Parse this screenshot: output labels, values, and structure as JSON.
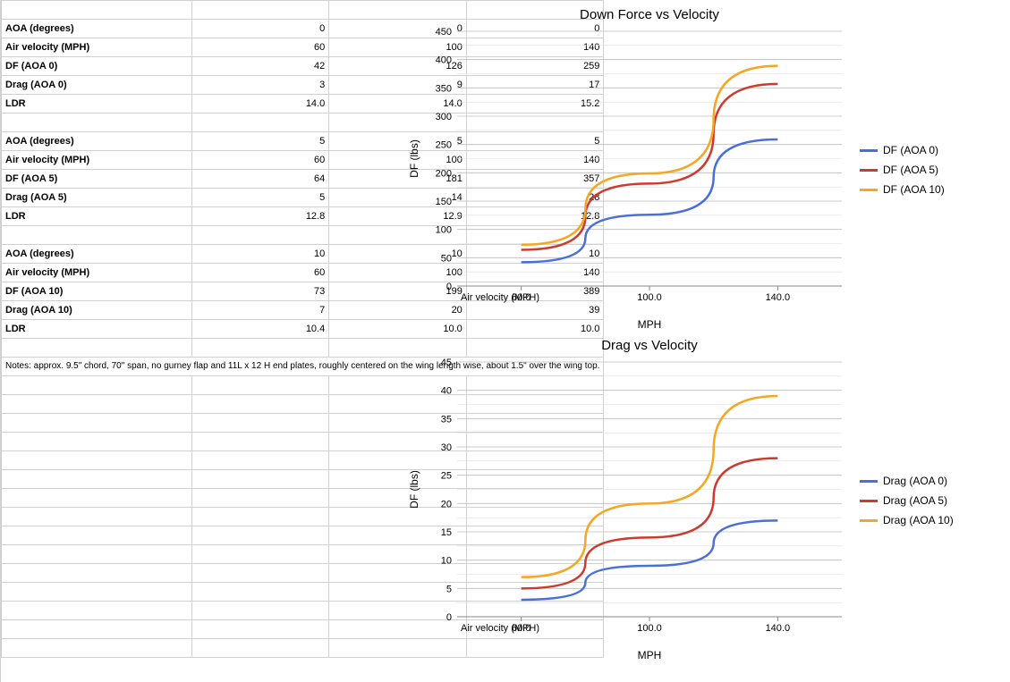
{
  "table": {
    "block0": {
      "rows": [
        {
          "label": "AOA (degrees)",
          "vals": [
            "0",
            "0",
            "0"
          ]
        },
        {
          "label": "Air velocity (MPH)",
          "vals": [
            "60",
            "100",
            "140"
          ]
        },
        {
          "label": "DF (AOA 0)",
          "vals": [
            "42",
            "126",
            "259"
          ]
        },
        {
          "label": "Drag (AOA 0)",
          "vals": [
            "3",
            "9",
            "17"
          ]
        },
        {
          "label": "LDR",
          "vals": [
            "14.0",
            "14.0",
            "15.2"
          ]
        }
      ]
    },
    "block1": {
      "rows": [
        {
          "label": "AOA (degrees)",
          "vals": [
            "5",
            "5",
            "5"
          ]
        },
        {
          "label": "Air velocity (MPH)",
          "vals": [
            "60",
            "100",
            "140"
          ]
        },
        {
          "label": "DF (AOA 5)",
          "vals": [
            "64",
            "181",
            "357"
          ]
        },
        {
          "label": "Drag (AOA 5)",
          "vals": [
            "5",
            "14",
            "28"
          ]
        },
        {
          "label": "LDR",
          "vals": [
            "12.8",
            "12.9",
            "12.8"
          ]
        }
      ]
    },
    "block2": {
      "rows": [
        {
          "label": "AOA (degrees)",
          "vals": [
            "10",
            "10",
            "10"
          ]
        },
        {
          "label": "Air velocity (MPH)",
          "vals": [
            "60",
            "100",
            "140"
          ]
        },
        {
          "label": "DF (AOA 10)",
          "vals": [
            "73",
            "199",
            "389"
          ]
        },
        {
          "label": "Drag (AOA 10)",
          "vals": [
            "7",
            "20",
            "39"
          ]
        },
        {
          "label": "LDR",
          "vals": [
            "10.4",
            "10.0",
            "10.0"
          ]
        }
      ]
    },
    "notes": "Notes: approx. 9.5\" chord, 70\" span, no gurney flap and 11L x 12 H end plates, roughly centered on the wing length wise, about 1.5\" over the wing top."
  },
  "chart_data": [
    {
      "type": "line",
      "title": "Down Force vs Velocity",
      "xlabel": "MPH",
      "ylabel": "DF (lbs)",
      "x_cat_label": "Air velocity (MPH)",
      "x_ticks": [
        "60.0",
        "100.0",
        "140.0"
      ],
      "ylim": [
        0,
        450
      ],
      "y_step": 50,
      "x": [
        60,
        100,
        140
      ],
      "series": [
        {
          "name": "DF (AOA 0)",
          "color": "#4a6fd8",
          "values": [
            42,
            126,
            259
          ]
        },
        {
          "name": "DF (AOA 5)",
          "color": "#cc3b2f",
          "values": [
            64,
            181,
            357
          ]
        },
        {
          "name": "DF (AOA 10)",
          "color": "#f5a623",
          "values": [
            73,
            199,
            389
          ]
        }
      ]
    },
    {
      "type": "line",
      "title": "Drag vs Velocity",
      "xlabel": "MPH",
      "ylabel": "DF (lbs)",
      "x_cat_label": "Air velocity (MPH)",
      "x_ticks": [
        "60.0",
        "100.0",
        "140.0"
      ],
      "ylim": [
        0,
        45
      ],
      "y_step": 5,
      "x": [
        60,
        100,
        140
      ],
      "series": [
        {
          "name": "Drag (AOA 0)",
          "color": "#4a6fd8",
          "values": [
            3,
            9,
            17
          ]
        },
        {
          "name": "Drag (AOA 5)",
          "color": "#cc3b2f",
          "values": [
            5,
            14,
            28
          ]
        },
        {
          "name": "Drag (AOA 10)",
          "color": "#f5a623",
          "values": [
            7,
            20,
            39
          ]
        }
      ]
    }
  ]
}
